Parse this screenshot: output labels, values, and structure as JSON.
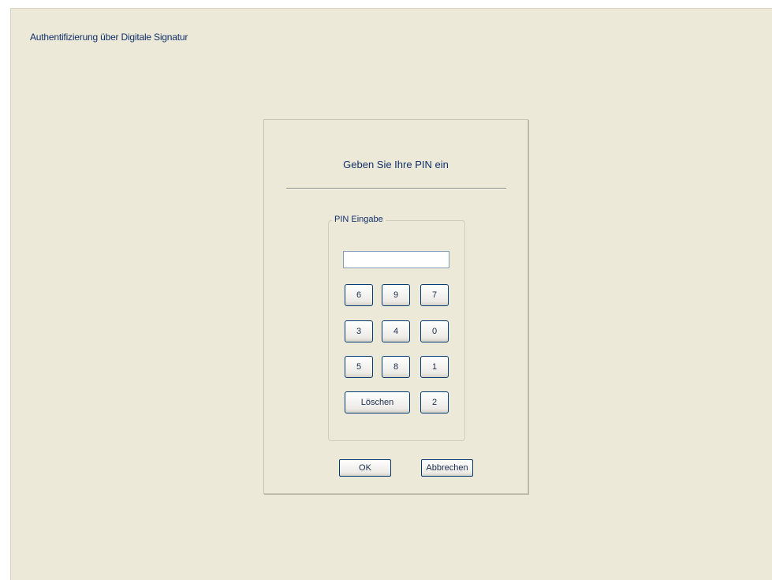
{
  "window": {
    "title": "Authentifizierung über Digitale Signatur"
  },
  "dialog": {
    "prompt": "Geben Sie Ihre PIN ein",
    "group_label": "PIN Eingabe",
    "pin_value": "",
    "keypad": {
      "row1": [
        "6",
        "9",
        "7"
      ],
      "row2": [
        "3",
        "4",
        "0"
      ],
      "row3": [
        "5",
        "8",
        "1"
      ],
      "clear_label": "Löschen",
      "last_digit": "2"
    },
    "ok_label": "OK",
    "cancel_label": "Abbrechen"
  }
}
